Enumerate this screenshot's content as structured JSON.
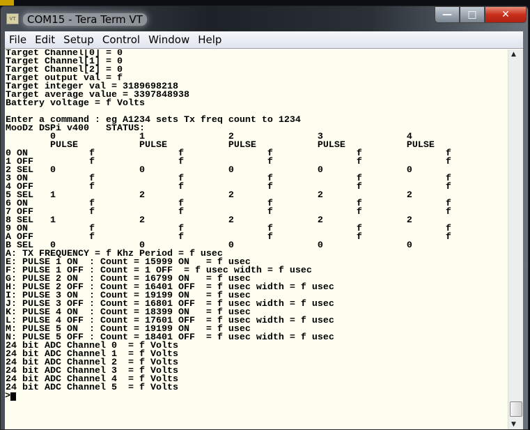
{
  "window": {
    "title": "COM15 - Tera Term VT",
    "icon_label": "VT"
  },
  "menu": [
    "File",
    "Edit",
    "Setup",
    "Control",
    "Window",
    "Help"
  ],
  "terminal": {
    "lines": [
      "Target Channel[0] = 0",
      "Target Channel[1] = 0",
      "Target Channel[2] = 0",
      "Target output val = f",
      "Target integer val = 3189698218",
      "Target average value = 3397848938",
      "Battery voltage = f Volts",
      "",
      "Enter a command : eg A1234 sets Tx freq count to 1234",
      "MooDz DSPi v400   STATUS:",
      "        0               1               2               3               4",
      "        PULSE           PULSE           PULSE           PULSE           PULSE",
      "0 ON           f               f               f               f               f",
      "1 OFF          f               f               f               f               f",
      "2 SEL   0               0               0               0               0",
      "3 ON           f               f               f               f               f",
      "4 OFF          f               f               f               f               f",
      "5 SEL   1               2               2               2               2",
      "6 ON           f               f               f               f               f",
      "7 OFF          f               f               f               f               f",
      "8 SEL   1               2               2               2               2",
      "9 ON           f               f               f               f               f",
      "A OFF          f               f               f               f               f",
      "B SEL   0               0               0               0               0",
      "A: TX FREQUENCY = f Khz Period = f usec",
      "E: PULSE 1 ON  : Count = 15999 ON   = f usec",
      "F: PULSE 1 OFF : Count = 1 OFF  = f usec width = f usec",
      "G: PULSE 2 ON  : Count = 16799 ON   = f usec",
      "H: PULSE 2 OFF : Count = 16401 OFF  = f usec width = f usec",
      "I: PULSE 3 ON  : Count = 19199 ON   = f usec",
      "J: PULSE 3 OFF : Count = 16801 OFF  = f usec width = f usec",
      "K: PULSE 4 ON  : Count = 18399 ON   = f usec",
      "L: PULSE 4 OFF : Count = 17601 OFF  = f usec width = f usec",
      "M: PULSE 5 ON  : Count = 19199 ON   = f usec",
      "N: PULSE 5 OFF : Count = 18401 OFF  = f usec width = f usec",
      "24 bit ADC Channel 0  = f Volts",
      "24 bit ADC Channel 1  = f Volts",
      "24 bit ADC Channel 2  = f Volts",
      "24 bit ADC Channel 3  = f Volts",
      "24 bit ADC Channel 4  = f Volts",
      "24 bit ADC Channel 5  = f Volts"
    ],
    "prompt": ">"
  }
}
